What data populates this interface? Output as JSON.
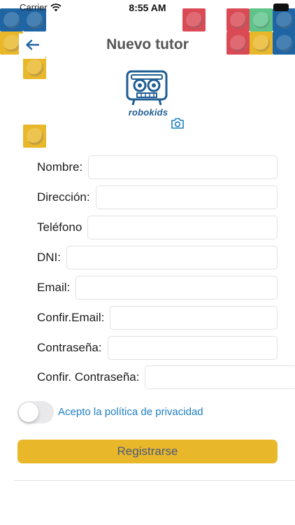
{
  "status_bar": {
    "carrier": "Carrier",
    "time": "8:55 AM"
  },
  "header": {
    "title": "Nuevo tutor",
    "back_icon": "arrow-left-icon"
  },
  "logo": {
    "text": "robokids",
    "icon": "robot-logo-icon",
    "camera_icon": "camera-icon"
  },
  "form": {
    "fields": [
      {
        "label": "Nombre:",
        "value": "",
        "placeholder": ""
      },
      {
        "label": "Dirección:",
        "value": "",
        "placeholder": ""
      },
      {
        "label": "Teléfono",
        "value": "",
        "placeholder": ""
      },
      {
        "label": "DNI:",
        "value": "",
        "placeholder": ""
      },
      {
        "label": "Email:",
        "value": "",
        "placeholder": ""
      },
      {
        "label": "Confir.Email:",
        "value": "",
        "placeholder": ""
      },
      {
        "label": "Contraseña:",
        "value": "",
        "placeholder": ""
      },
      {
        "label": "Confir. Contraseña:",
        "value": "",
        "placeholder": ""
      }
    ]
  },
  "privacy": {
    "label": "Acepto la política de privacidad",
    "accepted": false
  },
  "register_button": {
    "label": "Registrarse"
  },
  "colors": {
    "accent_yellow": "#e9b72a",
    "link_blue": "#1d7fc4",
    "brand_blue": "#1f5d93",
    "lego_blue": "#1f64a3",
    "lego_red": "#d94a55",
    "lego_green": "#5ec48a"
  }
}
